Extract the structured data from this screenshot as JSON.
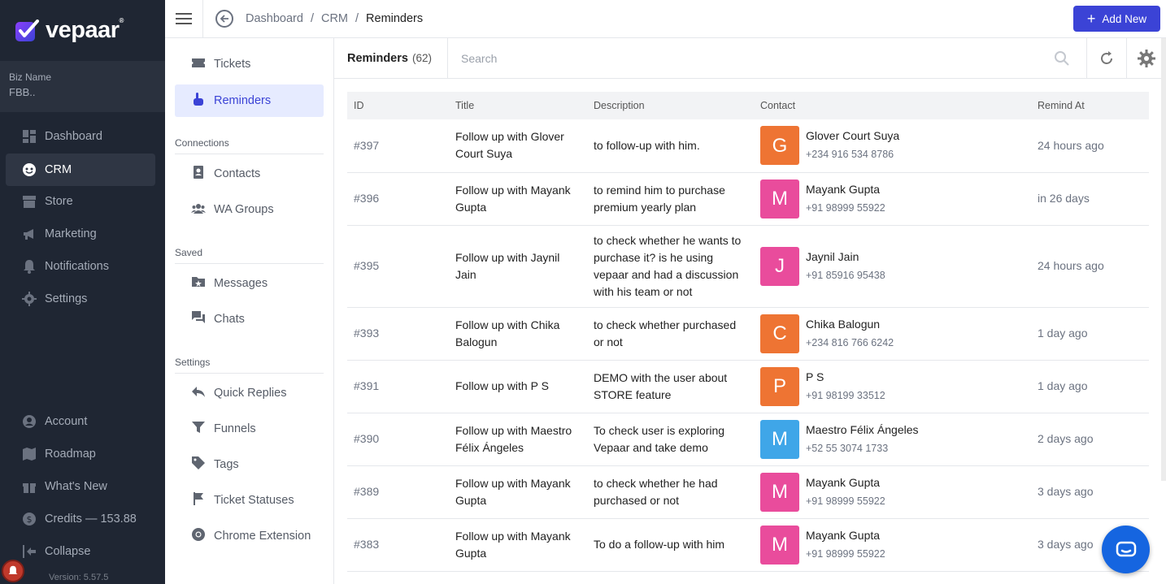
{
  "brand": {
    "name": "vepaar",
    "trademark": "®"
  },
  "biz": {
    "label": "Biz Name",
    "value": "FBB.."
  },
  "nav": [
    {
      "label": "Dashboard",
      "icon": "dashboard-icon"
    },
    {
      "label": "CRM",
      "icon": "crm-icon",
      "active": true
    },
    {
      "label": "Store",
      "icon": "store-icon"
    },
    {
      "label": "Marketing",
      "icon": "megaphone-icon"
    },
    {
      "label": "Notifications",
      "icon": "bell-icon"
    },
    {
      "label": "Settings",
      "icon": "gear-icon"
    }
  ],
  "nav_bottom": [
    {
      "label": "Account",
      "icon": "account-icon"
    },
    {
      "label": "Roadmap",
      "icon": "map-icon"
    },
    {
      "label": "What's New",
      "icon": "gift-icon"
    },
    {
      "label": "Credits — 153.88",
      "icon": "dollar-icon"
    },
    {
      "label": "Collapse",
      "icon": "collapse-icon"
    }
  ],
  "version": "Version: 5.57.5",
  "breadcrumb": {
    "items": [
      "Dashboard",
      "CRM",
      "Reminders"
    ],
    "sep": "/"
  },
  "add_new": {
    "label": "Add New",
    "plus": "+"
  },
  "submenu": {
    "tickets": "Tickets",
    "reminders": "Reminders",
    "connections_heading": "Connections",
    "contacts": "Contacts",
    "wa_groups": "WA Groups",
    "saved_heading": "Saved",
    "messages": "Messages",
    "chats": "Chats",
    "settings_heading": "Settings",
    "quick_replies": "Quick Replies",
    "funnels": "Funnels",
    "tags": "Tags",
    "ticket_statuses": "Ticket Statuses",
    "chrome_extension": "Chrome Extension"
  },
  "list": {
    "title": "Reminders",
    "count": "(62)",
    "search_placeholder": "Search"
  },
  "columns": {
    "id": "ID",
    "title": "Title",
    "description": "Description",
    "contact": "Contact",
    "remind_at": "Remind At"
  },
  "rows": [
    {
      "id": "#397",
      "title": "Follow up with Glover Court Suya",
      "description": "to follow-up with him.",
      "initial": "G",
      "color": "#ee7433",
      "name": "Glover Court Suya",
      "phone": "+234 916 534 8786",
      "when": "24 hours ago"
    },
    {
      "id": "#396",
      "title": "Follow up with Mayank Gupta",
      "description": "to remind him to purchase premium yearly plan",
      "initial": "M",
      "color": "#e94c9c",
      "name": "Mayank Gupta",
      "phone": "+91 98999 55922",
      "when": "in 26 days"
    },
    {
      "id": "#395",
      "title": "Follow up with Jaynil Jain",
      "description": "to check whether he wants to purchase it? is he using vepaar and had a discussion with his team or not",
      "initial": "J",
      "color": "#e94c9c",
      "name": "Jaynil Jain",
      "phone": "+91 85916 95438",
      "when": "24 hours ago"
    },
    {
      "id": "#393",
      "title": "Follow up with Chika Balogun",
      "description": "to check whether purchased or not",
      "initial": "C",
      "color": "#ee7433",
      "name": "Chika Balogun",
      "phone": "+234 816 766 6242",
      "when": "1 day ago"
    },
    {
      "id": "#391",
      "title": "Follow up with P S",
      "description": "DEMO with the user about STORE feature",
      "initial": "P",
      "color": "#ee7433",
      "name": "P S",
      "phone": "+91 98199 33512",
      "when": "1 day ago"
    },
    {
      "id": "#390",
      "title": "Follow up with Maestro Félix Ángeles",
      "description": "To check user is exploring Vepaar and take demo",
      "initial": "M",
      "color": "#3fa6e8",
      "name": "Maestro Félix Ángeles",
      "phone": "+52 55 3074 1733",
      "when": "2 days ago"
    },
    {
      "id": "#389",
      "title": "Follow up with Mayank Gupta",
      "description": "to check whether he had purchased or not",
      "initial": "M",
      "color": "#e94c9c",
      "name": "Mayank Gupta",
      "phone": "+91 98999 55922",
      "when": "3 days ago"
    },
    {
      "id": "#383",
      "title": "Follow up with Mayank Gupta",
      "description": "To do a follow-up with him",
      "initial": "M",
      "color": "#e94c9c",
      "name": "Mayank Gupta",
      "phone": "+91 98999 55922",
      "when": "3 days ago"
    }
  ],
  "colors": {
    "accent": "#3b43d6",
    "sidebar": "#1f2633",
    "fab": "#1565e0"
  }
}
